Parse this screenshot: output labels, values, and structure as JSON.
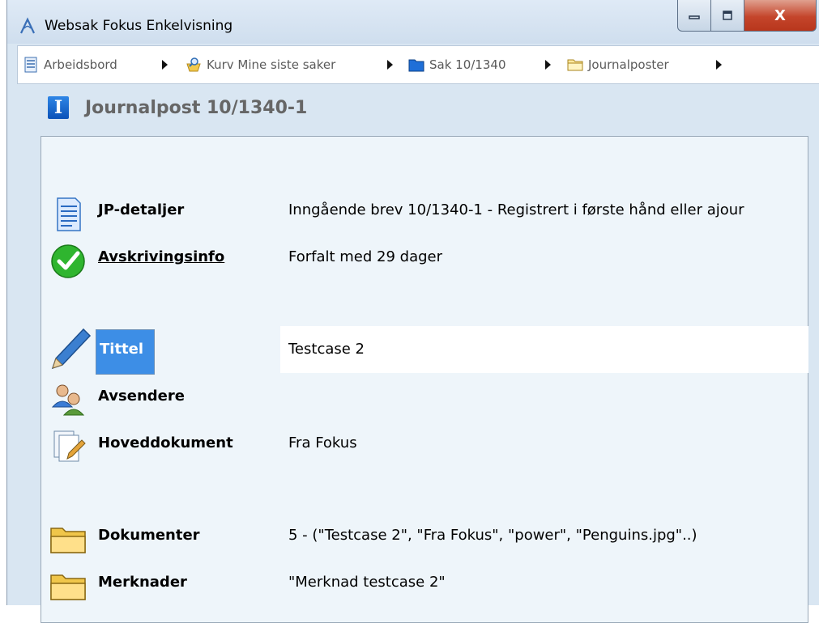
{
  "window": {
    "title": "Websak Fokus Enkelvisning",
    "controls": {
      "minimize": "▁",
      "maximize": "▢",
      "close": "X"
    }
  },
  "breadcrumb": [
    {
      "label": "Arbeidsbord",
      "icon": "document-list-icon"
    },
    {
      "label": "Kurv Mine siste saker",
      "icon": "basket-search-icon"
    },
    {
      "label": "Sak 10/1340",
      "icon": "blue-folder-icon"
    },
    {
      "label": "Journalposter",
      "icon": "folder-icon"
    }
  ],
  "heading": {
    "icon_letter": "I",
    "title": "Journalpost 10/1340-1"
  },
  "rows": [
    {
      "label": "JP-detaljer",
      "value": "Inngående brev 10/1340-1 - Registrert i første hånd eller ajour",
      "icon": "document-icon"
    },
    {
      "label": "Avskrivingsinfo",
      "value": "Forfalt med 29 dager",
      "icon": "checkmark-icon"
    },
    {
      "label": "Tittel",
      "value": "Testcase 2",
      "icon": "pencil-icon"
    },
    {
      "label": "Avsendere",
      "value": "",
      "icon": "users-icon"
    },
    {
      "label": "Hoveddokument",
      "value": "Fra Fokus",
      "icon": "documents-edit-icon"
    },
    {
      "label": "Dokumenter",
      "value": "5 - (\"Testcase 2\", \"Fra Fokus\", \"power\", \"Penguins.jpg\"..)",
      "icon": "folder-icon"
    },
    {
      "label": "Merknader",
      "value": "\"Merknad testcase 2\"",
      "icon": "folder-icon"
    }
  ],
  "colors": {
    "accent": "#3d8ee6",
    "panel_bg": "#eef5fa",
    "window_bg": "#d9e6f2"
  }
}
